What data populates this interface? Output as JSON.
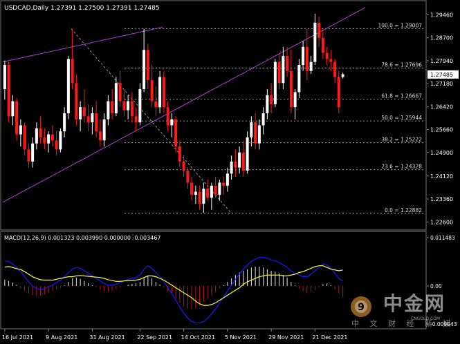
{
  "chart_data": [
    {
      "type": "candlestick",
      "symbol_line": "USDCAD,Daily  1.27391 1.27500 1.27391 1.27485",
      "current_price_label": "1.27485",
      "y_ticks": [
        "1.29460",
        "1.28700",
        "1.27940",
        "1.27180",
        "1.26420",
        "1.25660",
        "1.24900",
        "1.24120",
        "1.23360",
        "1.22600"
      ],
      "ylim": [
        1.224,
        1.2986
      ],
      "x_ticks": [
        "16 Jul 2021",
        "9 Aug 2021",
        "31 Aug 2021",
        "22 Sep 2021",
        "14 Oct 2021",
        "5 Nov 2021",
        "29 Nov 2021",
        "21 Dec 2021"
      ],
      "fib_levels": [
        {
          "label": "100.0 = 1.29007",
          "value": 1.29007
        },
        {
          "label": "78.6 = 1.27696",
          "value": 1.27696
        },
        {
          "label": "61.8 = 1.26667",
          "value": 1.26667
        },
        {
          "label": "50.0 = 1.25944",
          "value": 1.25944
        },
        {
          "label": "38.2 = 1.25222",
          "value": 1.25222
        },
        {
          "label": "23.6 = 1.24328",
          "value": 1.24328
        },
        {
          "label": "0.0 = 1.22882",
          "value": 1.22882
        }
      ],
      "candles": [
        [
          1.27,
          1.2795,
          1.2665,
          1.278
        ],
        [
          1.278,
          1.279,
          1.259,
          1.261
        ],
        [
          1.261,
          1.268,
          1.258,
          1.266
        ],
        [
          1.266,
          1.267,
          1.253,
          1.255
        ],
        [
          1.255,
          1.26,
          1.251,
          1.258
        ],
        [
          1.258,
          1.259,
          1.248,
          1.25
        ],
        [
          1.25,
          1.252,
          1.244,
          1.246
        ],
        [
          1.246,
          1.254,
          1.244,
          1.252
        ],
        [
          1.252,
          1.259,
          1.25,
          1.257
        ],
        [
          1.257,
          1.261,
          1.252,
          1.254
        ],
        [
          1.254,
          1.257,
          1.25,
          1.252
        ],
        [
          1.252,
          1.256,
          1.249,
          1.255
        ],
        [
          1.255,
          1.258,
          1.251,
          1.253
        ],
        [
          1.253,
          1.256,
          1.248,
          1.25
        ],
        [
          1.25,
          1.257,
          1.249,
          1.256
        ],
        [
          1.256,
          1.264,
          1.254,
          1.262
        ],
        [
          1.262,
          1.281,
          1.26,
          1.28
        ],
        [
          1.28,
          1.29,
          1.27,
          1.272
        ],
        [
          1.272,
          1.275,
          1.258,
          1.26
        ],
        [
          1.26,
          1.266,
          1.256,
          1.264
        ],
        [
          1.264,
          1.27,
          1.259,
          1.261
        ],
        [
          1.261,
          1.265,
          1.256,
          1.259
        ],
        [
          1.259,
          1.264,
          1.255,
          1.262
        ],
        [
          1.262,
          1.266,
          1.254,
          1.256
        ],
        [
          1.256,
          1.26,
          1.251,
          1.253
        ],
        [
          1.253,
          1.262,
          1.251,
          1.26
        ],
        [
          1.26,
          1.268,
          1.258,
          1.266
        ],
        [
          1.266,
          1.27,
          1.26,
          1.262
        ],
        [
          1.262,
          1.274,
          1.261,
          1.272
        ],
        [
          1.272,
          1.276,
          1.264,
          1.266
        ],
        [
          1.266,
          1.27,
          1.261,
          1.263
        ],
        [
          1.263,
          1.268,
          1.26,
          1.266
        ],
        [
          1.266,
          1.269,
          1.259,
          1.261
        ],
        [
          1.261,
          1.264,
          1.256,
          1.259
        ],
        [
          1.259,
          1.272,
          1.258,
          1.27
        ],
        [
          1.27,
          1.29,
          1.269,
          1.283
        ],
        [
          1.283,
          1.285,
          1.27,
          1.273
        ],
        [
          1.273,
          1.278,
          1.264,
          1.266
        ],
        [
          1.266,
          1.271,
          1.261,
          1.264
        ],
        [
          1.264,
          1.276,
          1.262,
          1.274
        ],
        [
          1.274,
          1.276,
          1.262,
          1.264
        ],
        [
          1.264,
          1.266,
          1.256,
          1.258
        ],
        [
          1.258,
          1.262,
          1.254,
          1.26
        ],
        [
          1.26,
          1.261,
          1.249,
          1.251
        ],
        [
          1.251,
          1.253,
          1.244,
          1.246
        ],
        [
          1.246,
          1.248,
          1.241,
          1.243
        ],
        [
          1.243,
          1.244,
          1.237,
          1.239
        ],
        [
          1.239,
          1.241,
          1.233,
          1.235
        ],
        [
          1.235,
          1.238,
          1.232,
          1.236
        ],
        [
          1.236,
          1.238,
          1.23,
          1.232
        ],
        [
          1.232,
          1.239,
          1.229,
          1.237
        ],
        [
          1.237,
          1.24,
          1.233,
          1.234
        ],
        [
          1.234,
          1.239,
          1.23,
          1.238
        ],
        [
          1.238,
          1.241,
          1.234,
          1.235
        ],
        [
          1.235,
          1.24,
          1.233,
          1.239
        ],
        [
          1.239,
          1.241,
          1.235,
          1.238
        ],
        [
          1.238,
          1.244,
          1.236,
          1.242
        ],
        [
          1.242,
          1.248,
          1.24,
          1.246
        ],
        [
          1.246,
          1.25,
          1.241,
          1.244
        ],
        [
          1.244,
          1.251,
          1.242,
          1.249
        ],
        [
          1.249,
          1.253,
          1.241,
          1.243
        ],
        [
          1.243,
          1.256,
          1.242,
          1.254
        ],
        [
          1.254,
          1.261,
          1.251,
          1.259
        ],
        [
          1.259,
          1.262,
          1.25,
          1.252
        ],
        [
          1.252,
          1.26,
          1.25,
          1.258
        ],
        [
          1.258,
          1.264,
          1.255,
          1.262
        ],
        [
          1.262,
          1.27,
          1.26,
          1.268
        ],
        [
          1.268,
          1.272,
          1.262,
          1.265
        ],
        [
          1.265,
          1.28,
          1.264,
          1.279
        ],
        [
          1.279,
          1.282,
          1.27,
          1.272
        ],
        [
          1.272,
          1.284,
          1.27,
          1.281
        ],
        [
          1.281,
          1.284,
          1.274,
          1.276
        ],
        [
          1.276,
          1.283,
          1.262,
          1.264
        ],
        [
          1.264,
          1.27,
          1.26,
          1.269
        ],
        [
          1.269,
          1.28,
          1.267,
          1.278
        ],
        [
          1.278,
          1.286,
          1.276,
          1.284
        ],
        [
          1.284,
          1.29,
          1.273,
          1.276
        ],
        [
          1.276,
          1.281,
          1.275,
          1.279
        ],
        [
          1.279,
          1.295,
          1.278,
          1.292
        ],
        [
          1.292,
          1.294,
          1.284,
          1.287
        ],
        [
          1.287,
          1.29,
          1.28,
          1.282
        ],
        [
          1.282,
          1.284,
          1.278,
          1.28
        ],
        [
          1.28,
          1.283,
          1.276,
          1.279
        ],
        [
          1.279,
          1.28,
          1.272,
          1.274
        ],
        [
          1.274,
          1.276,
          1.262,
          1.264
        ],
        [
          1.274,
          1.2755,
          1.2735,
          1.2749
        ]
      ]
    },
    {
      "type": "histogram+line",
      "indicator_label": "MACD(12,26,9) 0.001323 0.003990 0.000000 -0.003467",
      "y_ticks": [
        "0.011483",
        "0.00",
        "-0.009043"
      ],
      "ylim": [
        -0.0095,
        0.0118
      ],
      "histogram": [
        0.0015,
        0.0012,
        0.0008,
        0.0003,
        -0.0005,
        -0.0012,
        -0.0018,
        -0.0022,
        -0.0024,
        -0.0023,
        -0.002,
        -0.0016,
        -0.0012,
        -0.0008,
        -0.0004,
        0.0002,
        0.001,
        0.0018,
        0.002,
        0.0017,
        0.0012,
        0.0007,
        0.0002,
        -0.0003,
        -0.0008,
        -0.0012,
        -0.0013,
        -0.0011,
        -0.0007,
        -0.0003,
        0.0,
        0.0003,
        0.0005,
        0.0006,
        0.001,
        0.002,
        0.0024,
        0.0018,
        0.001,
        0.0004,
        -0.0004,
        -0.0012,
        -0.002,
        -0.003,
        -0.004,
        -0.0048,
        -0.0054,
        -0.0056,
        -0.0052,
        -0.0046,
        -0.0038,
        -0.003,
        -0.0022,
        -0.0014,
        -0.0006,
        0.0002,
        0.001,
        0.0018,
        0.0026,
        0.0032,
        0.0036,
        0.004,
        0.0044,
        0.0046,
        0.0046,
        0.0044,
        0.004,
        0.0036,
        0.0034,
        0.003,
        0.0026,
        0.002,
        0.001,
        0.0002,
        -0.0006,
        -0.0012,
        -0.0016,
        -0.0014,
        -0.001,
        -0.0004,
        0.0004,
        0.0006,
        0.0002,
        -0.0008,
        -0.0018,
        -0.0026
      ],
      "macd": [
        0.006,
        0.0058,
        0.0052,
        0.0044,
        0.0034,
        0.0022,
        0.001,
        0.0,
        -0.0006,
        -0.0008,
        -0.0006,
        -0.0002,
        0.0002,
        0.0008,
        0.0014,
        0.0022,
        0.0032,
        0.004,
        0.0044,
        0.0042,
        0.0036,
        0.003,
        0.0024,
        0.0018,
        0.0012,
        0.0006,
        0.0002,
        0.0002,
        0.0004,
        0.0008,
        0.0012,
        0.0016,
        0.0018,
        0.002,
        0.0026,
        0.004,
        0.0048,
        0.0042,
        0.0032,
        0.0022,
        0.001,
        -0.0004,
        -0.0018,
        -0.0034,
        -0.005,
        -0.0064,
        -0.0076,
        -0.0084,
        -0.0088,
        -0.0088,
        -0.0084,
        -0.0076,
        -0.0066,
        -0.0054,
        -0.004,
        -0.0026,
        -0.0012,
        0.0002,
        0.0016,
        0.0028,
        0.004,
        0.005,
        0.0058,
        0.0064,
        0.0068,
        0.0068,
        0.0066,
        0.0062,
        0.006,
        0.0056,
        0.005,
        0.0044,
        0.0036,
        0.003,
        0.0026,
        0.0022,
        0.0022,
        0.0028,
        0.0036,
        0.0044,
        0.0052,
        0.005,
        0.0042,
        0.003,
        0.0018,
        0.0012
      ],
      "signal": [
        0.0045,
        0.0046,
        0.0044,
        0.0041,
        0.0039,
        0.0034,
        0.0028,
        0.0022,
        0.0018,
        0.0015,
        0.0014,
        0.0014,
        0.0014,
        0.0016,
        0.0018,
        0.002,
        0.0022,
        0.0022,
        0.0024,
        0.0025,
        0.0024,
        0.0023,
        0.0022,
        0.0021,
        0.002,
        0.0018,
        0.0015,
        0.0013,
        0.0011,
        0.0011,
        0.0012,
        0.0013,
        0.0013,
        0.0014,
        0.0016,
        0.002,
        0.0024,
        0.0024,
        0.0022,
        0.0018,
        0.0014,
        0.0008,
        0.0002,
        -0.0004,
        -0.001,
        -0.0016,
        -0.0022,
        -0.0028,
        -0.0036,
        -0.0042,
        -0.0046,
        -0.0046,
        -0.0044,
        -0.004,
        -0.0034,
        -0.0028,
        -0.0022,
        -0.0016,
        -0.001,
        -0.0004,
        0.0004,
        0.001,
        0.0014,
        0.0018,
        0.0022,
        0.0024,
        0.0026,
        0.0026,
        0.0026,
        0.0026,
        0.0024,
        0.0024,
        0.0026,
        0.0028,
        0.0032,
        0.0034,
        0.0038,
        0.0042,
        0.0046,
        0.0048,
        0.0048,
        0.0044,
        0.004,
        0.0038,
        0.0036,
        0.0038
      ]
    }
  ],
  "watermark": {
    "brand": "中金网",
    "subtitle": "中 文 财 经 新 媒 体",
    "url": "CNGOLD.COM"
  },
  "colors": {
    "bull": "#ffffff",
    "bear": "#ff1a1a",
    "channel": "#b040d8",
    "macd": "#1a1aff",
    "signal": "#ffff33",
    "grid": "#c8c8c8"
  }
}
